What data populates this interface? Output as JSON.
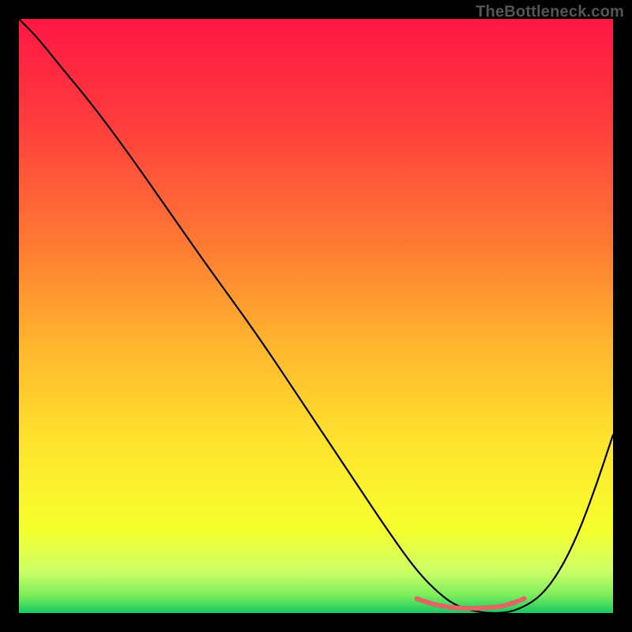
{
  "watermark": "TheBottleneck.com",
  "chart_data": {
    "type": "line",
    "title": "",
    "xlabel": "",
    "ylabel": "",
    "xlim": [
      0,
      100
    ],
    "ylim": [
      0,
      100
    ],
    "grid": false,
    "background_gradient": {
      "stops": [
        {
          "offset": 0.0,
          "color": "#ff1744"
        },
        {
          "offset": 0.18,
          "color": "#ff3d3d"
        },
        {
          "offset": 0.38,
          "color": "#ff7a33"
        },
        {
          "offset": 0.55,
          "color": "#ffb62e"
        },
        {
          "offset": 0.72,
          "color": "#ffe52e"
        },
        {
          "offset": 0.86,
          "color": "#f6ff2e"
        },
        {
          "offset": 0.93,
          "color": "#ccff66"
        },
        {
          "offset": 0.97,
          "color": "#7bed5b"
        },
        {
          "offset": 1.0,
          "color": "#18c964"
        }
      ]
    },
    "series": [
      {
        "name": "bottleneck-curve",
        "color": "#000000",
        "width": 2.2,
        "x": [
          0,
          3,
          7,
          12,
          18,
          25,
          32,
          40,
          48,
          56,
          62,
          67,
          71,
          74,
          78,
          82,
          85,
          88,
          91,
          94,
          97,
          100
        ],
        "y": [
          100,
          97,
          92,
          86,
          78,
          68,
          58,
          47,
          35,
          23,
          14,
          7,
          3,
          1,
          0,
          0,
          1,
          3,
          7,
          13,
          21,
          30
        ]
      },
      {
        "name": "optimal-zone-marker",
        "color": "#e06666",
        "width": 6,
        "x": [
          67,
          69,
          71,
          73,
          75,
          77,
          79,
          81,
          83,
          85
        ],
        "y": [
          2.4,
          1.7,
          1.2,
          0.9,
          0.8,
          0.8,
          0.9,
          1.1,
          1.6,
          2.4
        ]
      }
    ],
    "annotations": []
  }
}
